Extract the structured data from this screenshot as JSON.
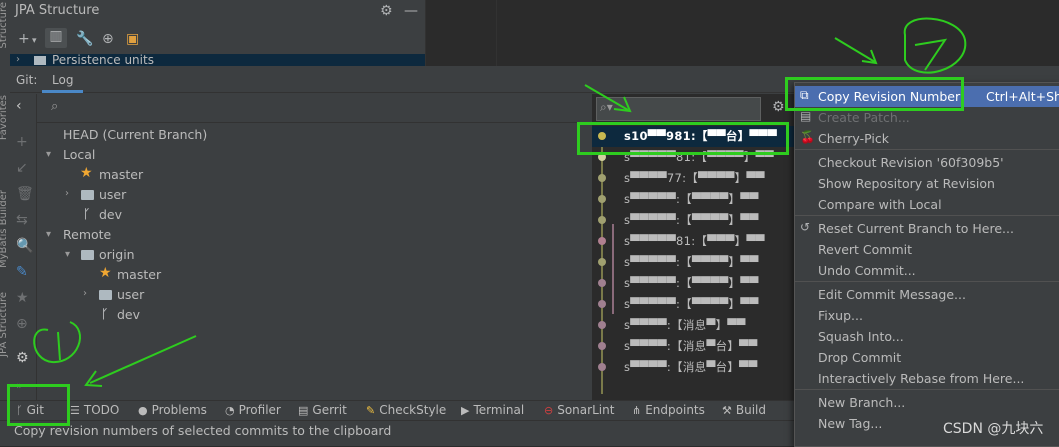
{
  "side_labels": {
    "top": "Structure",
    "mid1": "Favorites",
    "mid2": "MyBatis Builder",
    "bottom": "JPA Structure"
  },
  "jpa_panel": {
    "title": "JPA Structure",
    "row": "Persistence units"
  },
  "git": {
    "window_label": "Git:",
    "tab_log": "Log",
    "tree": {
      "head": "HEAD (Current Branch)",
      "local": "Local",
      "local_master": "master",
      "local_user": "user",
      "local_dev": "dev",
      "remote": "Remote",
      "origin": "origin",
      "remote_master": "master",
      "remote_user": "user",
      "remote_dev": "dev"
    },
    "log_rows": [
      "s10▀▀981:【▀▀台】▀▀▀",
      "s▀▀▀▀▀81:【▀▀▀▀】▀▀",
      "s▀▀▀▀77:【▀▀▀▀】▀▀",
      "s▀▀▀▀▀:【▀▀▀▀】▀▀",
      "s▀▀▀▀▀:【▀▀▀▀】▀▀",
      "s▀▀▀▀▀81:【▀▀▀】▀▀",
      "s▀▀▀▀▀:【▀▀▀▀】▀▀",
      "s▀▀▀▀▀:【▀▀▀▀】▀▀",
      "s▀▀▀▀▀:【▀▀▀▀】▀▀",
      "s▀▀▀▀:【消息▀】▀▀",
      "s▀▀▀▀:【消息▀台】▀▀",
      "s▀▀▀▀:【消息▀台】▀▀"
    ]
  },
  "menu": {
    "items": [
      {
        "label": "Copy Revision Number",
        "shortcut": "Ctrl+Alt+Shif",
        "icon": "copy-icon"
      },
      {
        "label": "Create Patch...",
        "icon": "patch-icon"
      },
      {
        "label": "Cherry-Pick",
        "icon": "cherry-icon"
      },
      {
        "label": "Checkout Revision '60f309b5'"
      },
      {
        "label": "Show Repository at Revision"
      },
      {
        "label": "Compare with Local"
      },
      {
        "label": "Reset Current Branch to Here...",
        "icon": "undo-icon"
      },
      {
        "label": "Revert Commit"
      },
      {
        "label": "Undo Commit..."
      },
      {
        "label": "Edit Commit Message..."
      },
      {
        "label": "Fixup..."
      },
      {
        "label": "Squash Into..."
      },
      {
        "label": "Drop Commit"
      },
      {
        "label": "Interactively Rebase from Here..."
      },
      {
        "label": "New Branch..."
      },
      {
        "label": "New Tag..."
      }
    ]
  },
  "toolbar": {
    "git": "Git",
    "todo": "TODO",
    "problems": "Problems",
    "profiler": "Profiler",
    "gerrit": "Gerrit",
    "checkstyle": "CheckStyle",
    "terminal": "Terminal",
    "sonarlint": "SonarLint",
    "endpoints": "Endpoints",
    "build": "Build"
  },
  "status": {
    "message": "Copy revision numbers of selected commits to the clipboard"
  },
  "watermark": "CSDN @九块六",
  "colors": {
    "accent": "#4b6eaf",
    "annotation": "#2ecc1f",
    "star": "#f0a732"
  }
}
